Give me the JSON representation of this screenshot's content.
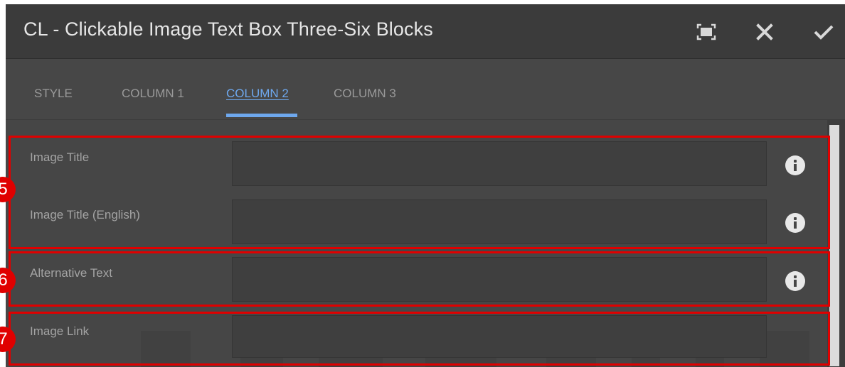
{
  "dialog": {
    "title": "CL - Clickable Image Text Box Three-Six Blocks",
    "actions": {
      "fullscreen": "fullscreen-icon",
      "close": "close-icon",
      "done": "checkmark-icon"
    }
  },
  "tabs": [
    {
      "label": "STYLE",
      "active": false
    },
    {
      "label": "COLUMN 1",
      "active": false
    },
    {
      "label": "COLUMN 2",
      "active": true
    },
    {
      "label": "COLUMN 3",
      "active": false
    }
  ],
  "fields": [
    {
      "label": "Image Title",
      "value": "",
      "has_info": true
    },
    {
      "label": "Image Title (English)",
      "value": "",
      "has_info": true
    },
    {
      "label": "Alternative Text",
      "value": "",
      "has_info": true
    },
    {
      "label": "Image Link",
      "value": "",
      "has_info": false
    }
  ],
  "annotations": [
    {
      "number": "5",
      "color": "#e00000"
    },
    {
      "number": "6",
      "color": "#e00000"
    },
    {
      "number": "7",
      "color": "#e00000"
    }
  ],
  "colors": {
    "accent": "#6ea8ee",
    "highlight": "#e00000",
    "header_bg": "#3b3b3b",
    "panel_bg": "#474747"
  }
}
